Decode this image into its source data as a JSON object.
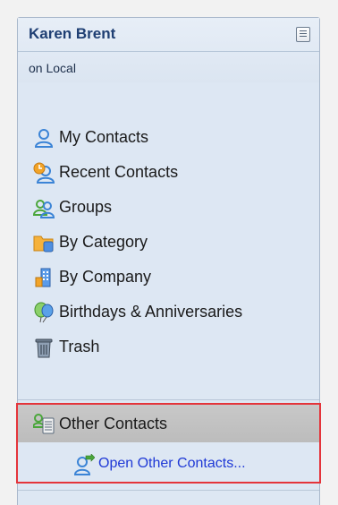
{
  "header": {
    "user_name": "Karen Brent",
    "location": "on Local",
    "menu_icon": "page-menu-icon"
  },
  "nav": {
    "items": [
      {
        "label": "My Contacts",
        "icon": "person-icon"
      },
      {
        "label": "Recent Contacts",
        "icon": "clock-person-icon"
      },
      {
        "label": "Groups",
        "icon": "group-icon"
      },
      {
        "label": "By Category",
        "icon": "folder-icon"
      },
      {
        "label": "By Company",
        "icon": "building-icon"
      },
      {
        "label": "Birthdays & Anniversaries",
        "icon": "balloon-icon"
      },
      {
        "label": "Trash",
        "icon": "trash-icon"
      }
    ]
  },
  "other": {
    "header_label": "Other Contacts",
    "open_link_label": "Open Other Contacts...",
    "highlight_color": "#e4343a",
    "link_color": "#1f39d6"
  }
}
